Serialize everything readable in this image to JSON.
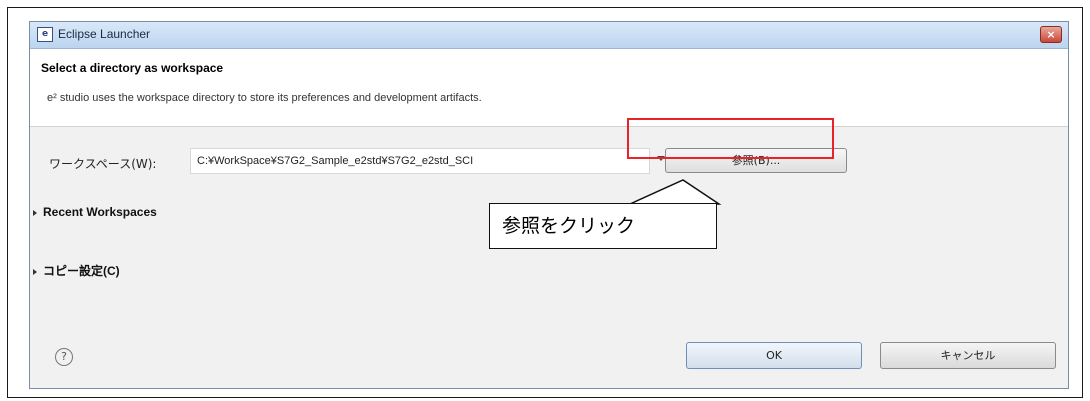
{
  "window": {
    "title": "Eclipse Launcher",
    "app_icon_glyph": "e",
    "close_glyph": "×"
  },
  "header": {
    "title": "Select a directory as workspace",
    "description": "e² studio uses the workspace directory to store its preferences and development artifacts."
  },
  "workspace": {
    "label": "ワークスペース(W):",
    "value": "C:¥WorkSpace¥S7G2_Sample_e2std¥S7G2_e2std_SCI",
    "browse_label": "参照(B)..."
  },
  "sections": {
    "recent_workspaces": "Recent Workspaces",
    "copy_settings": "コピー設定(C)"
  },
  "callout": {
    "text": "参照をクリック"
  },
  "footer": {
    "help_glyph": "?",
    "ok_label": "OK",
    "cancel_label": "キャンセル"
  },
  "colors": {
    "highlight": "#e8242a",
    "titlebar": "#bcd4ef"
  },
  "icons": {
    "help": "help-icon",
    "close": "close-icon",
    "app": "eclipse-app-icon",
    "dropdown": "chevron-down-icon"
  }
}
